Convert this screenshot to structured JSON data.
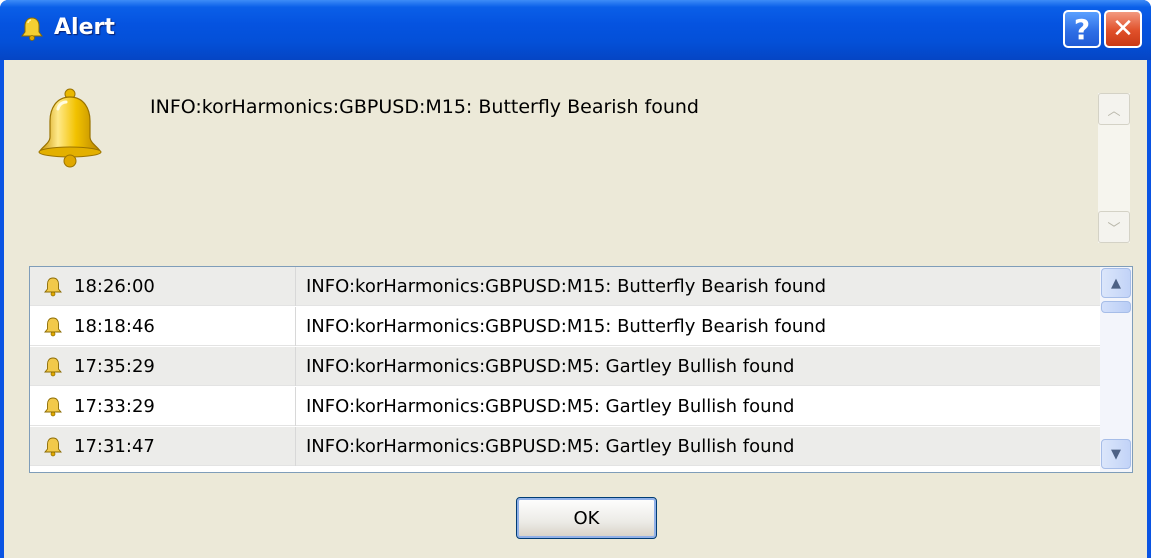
{
  "window": {
    "title": "Alert",
    "help_label": "?",
    "close_label": "✕"
  },
  "message": {
    "text": "INFO:korHarmonics:GBPUSD:M15: Butterfly Bearish found"
  },
  "alerts": {
    "rows": [
      {
        "time": "18:26:00",
        "message": "INFO:korHarmonics:GBPUSD:M15: Butterfly Bearish found",
        "icon": "bell-icon"
      },
      {
        "time": "18:18:46",
        "message": "INFO:korHarmonics:GBPUSD:M15: Butterfly Bearish found",
        "icon": "bell-icon"
      },
      {
        "time": "17:35:29",
        "message": "INFO:korHarmonics:GBPUSD:M5: Gartley Bullish found",
        "icon": "bell-icon"
      },
      {
        "time": "17:33:29",
        "message": "INFO:korHarmonics:GBPUSD:M5: Gartley Bullish found",
        "icon": "bell-icon"
      },
      {
        "time": "17:31:47",
        "message": "INFO:korHarmonics:GBPUSD:M5: Gartley Bullish found",
        "icon": "bell-icon"
      }
    ]
  },
  "buttons": {
    "ok_label": "OK"
  },
  "colors": {
    "titlebar": "#0553e0",
    "client_bg": "#ece9d8",
    "bell_gold": "#f2c200"
  }
}
